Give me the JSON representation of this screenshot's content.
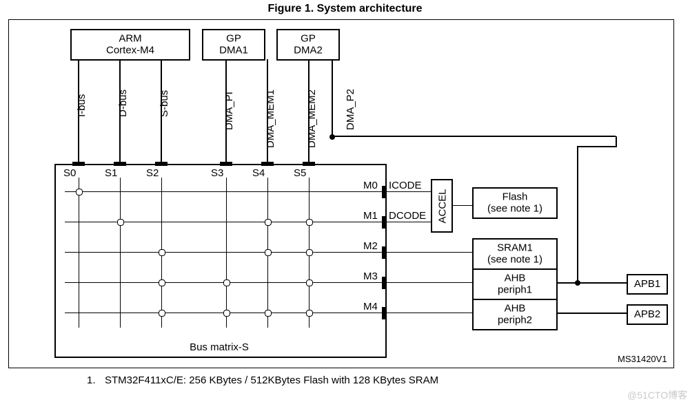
{
  "title": "Figure 1. System architecture",
  "masters": {
    "cpu": {
      "line1": "ARM",
      "line2": "Cortex-M4"
    },
    "dma1": {
      "line1": "GP",
      "line2": "DMA1"
    },
    "dma2": {
      "line1": "GP",
      "line2": "DMA2"
    }
  },
  "buslabels": {
    "ibus": "I-bus",
    "dbus": "D-bus",
    "sbus": "S-bus",
    "dmapi": "DMA_PI",
    "dmamem1": "DMA_MEM1",
    "dmamem2": "DMA_MEM2",
    "dmap2": "DMA_P2"
  },
  "sports": {
    "s0": "S0",
    "s1": "S1",
    "s2": "S2",
    "s3": "S3",
    "s4": "S4",
    "s5": "S5"
  },
  "mports": {
    "m0": "M0",
    "m1": "M1",
    "m2": "M2",
    "m3": "M3",
    "m4": "M4"
  },
  "mlabels": {
    "icode": "ICODE",
    "dcode": "DCODE"
  },
  "slaves": {
    "accel": "ACCEL",
    "flash": {
      "line1": "Flash",
      "line2": "(see note 1)"
    },
    "sram1": {
      "line1": "SRAM1",
      "line2": "(see note 1)"
    },
    "ahb1": {
      "line1": "AHB",
      "line2": "periph1"
    },
    "ahb2": {
      "line1": "AHB",
      "line2": "periph2"
    },
    "apb1": "APB1",
    "apb2": "APB2"
  },
  "matrixlabel": "Bus matrix-S",
  "docid": "MS31420V1",
  "footnote": {
    "num": "1.",
    "text": "STM32F411xC/E:  256 KBytes / 512KBytes Flash with 128 KBytes SRAM"
  },
  "watermark": "@51CTO博客"
}
